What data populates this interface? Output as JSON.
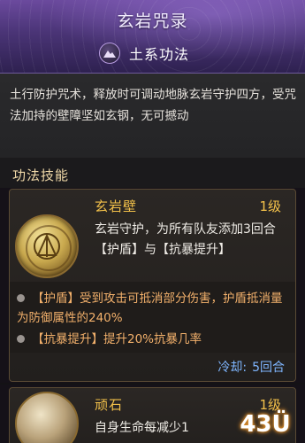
{
  "header": {
    "title": "玄岩咒录",
    "school_icon": "mountain-icon",
    "school": "土系功法"
  },
  "description": "土行防护咒术，释放时可调动地脉玄岩守护四方，受咒法加持的壁障坚如玄钢，无可撼动",
  "section": {
    "title": "功法技能"
  },
  "skills": [
    {
      "name": "玄岩壁",
      "level": "1级",
      "icon": "golden-seal-icon",
      "description": "玄岩守护，为所有队友添加3回合【护盾】与【抗暴提升】",
      "effects": [
        "【护盾】受到攻击可抵消部分伤害，护盾抵消量为防御属性的240%",
        "【抗暴提升】提升20%抗暴几率"
      ],
      "cooldown_label": "冷却:",
      "cooldown_value": "5回合"
    },
    {
      "name": "顽石",
      "level": "1级",
      "icon": "stone-emblem-icon",
      "description": "自身生命每减少1"
    }
  ],
  "watermark": "43Ü",
  "colors": {
    "header_purple": "#4a3476",
    "skill_gold": "#f3c14a",
    "effect_orange": "#f2b06b",
    "cooldown_blue": "#7fb6ff"
  }
}
